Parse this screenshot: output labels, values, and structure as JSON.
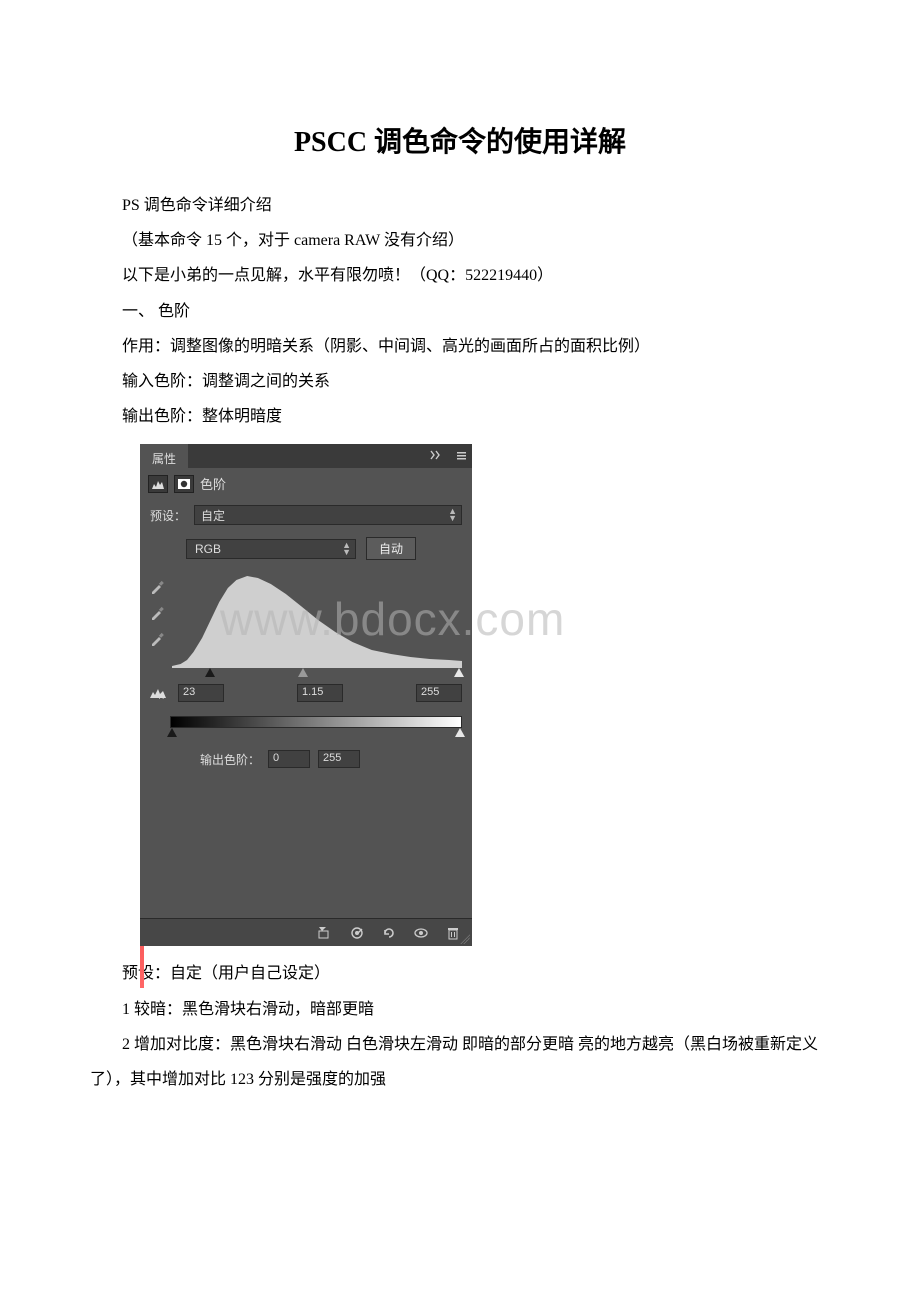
{
  "doc": {
    "title": "PSCC 调色命令的使用详解",
    "p1": "PS 调色命令详细介绍",
    "p2": "（基本命令 15 个，对于 camera RAW 没有介绍）",
    "p3": "以下是小弟的一点见解，水平有限勿喷！（QQ：522219440）",
    "p4": "一、 色阶",
    "p5": "作用：调整图像的明暗关系（阴影、中间调、高光的画面所占的面积比例）",
    "p6": "输入色阶：调整调之间的关系",
    "p7": "输出色阶：整体明暗度",
    "p8": "预设：自定（用户自己设定）",
    "p9": "1 较暗：黑色滑块右滑动，暗部更暗",
    "p10": "2 增加对比度：黑色滑块右滑动 白色滑块左滑动 即暗的部分更暗 亮的地方越亮（黑白场被重新定义了），其中增加对比 123 分别是强度的加强"
  },
  "watermark": "www.bdocx.com",
  "panel": {
    "tab": "属性",
    "title": "色阶",
    "preset_label": "预设：",
    "preset_value": "自定",
    "channel_value": "RGB",
    "auto_label": "自动",
    "input_black": "23",
    "input_gamma": "1.15",
    "input_white": "255",
    "output_label": "输出色阶：",
    "output_black": "0",
    "output_white": "255"
  }
}
